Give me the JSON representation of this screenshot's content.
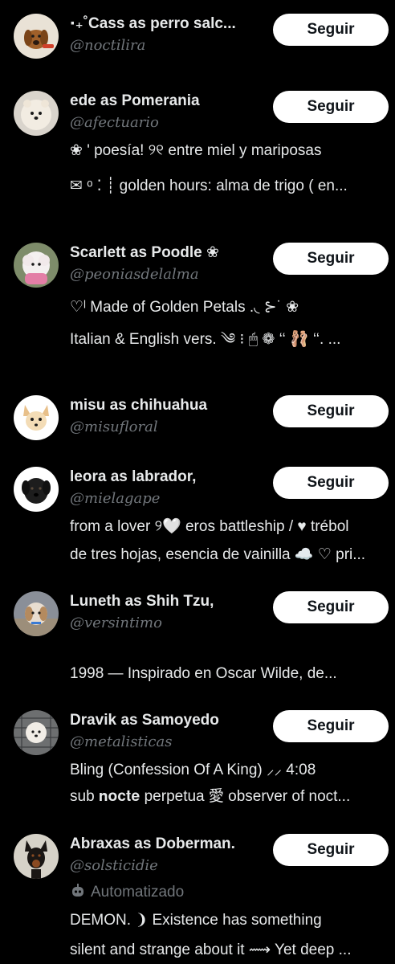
{
  "colors": {
    "background": "#000000",
    "primary_text": "#e7e9ea",
    "secondary_text": "#71767b",
    "button_bg": "#ffffff",
    "button_text": "#0f1419"
  },
  "users": [
    {
      "display_name": "‧₊˚Cass as perro salc...",
      "handle": "@noctilira",
      "follow_label": "Seguir",
      "avatar_icon": "dachshund-avatar",
      "bio": []
    },
    {
      "display_name": "ede as Pomerania",
      "handle": "@afectuario",
      "follow_label": "Seguir",
      "avatar_icon": "pomeranian-avatar",
      "bio": [
        "❀ '    poesía! ୨୧    entre miel y mariposas",
        "✉︎ ᵒ ⁚ ┊ golden hours: alma de trigo ( en..."
      ]
    },
    {
      "display_name": "Scarlett as Poodle ❀",
      "handle": "@peoniasdelalma",
      "follow_label": "Seguir",
      "avatar_icon": "poodle-avatar",
      "bio": [
        "♡ˡ    Made of Golden Petals    .◟    ⊱˙ ❀",
        "Italian & English vers. ༄    ⁝ 🖱 ❁ ‘‘ 🩰 ‘‘. ..."
      ]
    },
    {
      "display_name": "misu as chihuahua",
      "handle": "@misufloral",
      "follow_label": "Seguir",
      "avatar_icon": "chihuahua-avatar",
      "bio": []
    },
    {
      "display_name": "leora as labrador,",
      "handle": "@mielagape",
      "follow_label": "Seguir",
      "avatar_icon": "labrador-avatar",
      "bio": [
        "from a lover ୨🤍 eros battleship / ♥ trébol",
        "de tres hojas, esencia de vainilla ☁️ ♡ pri..."
      ]
    },
    {
      "display_name": "Luneth as Shih Tzu,",
      "handle": "@versintimo",
      "follow_label": "Seguir",
      "avatar_icon": "shih-tzu-avatar",
      "bio": [
        "",
        "1998    —    Inspirado en Oscar Wilde, de..."
      ]
    },
    {
      "display_name": "Dravik as Samoyedo",
      "handle": "@metalisticas",
      "follow_label": "Seguir",
      "avatar_icon": "samoyed-avatar",
      "bio": [
        "    Bling (Confession Of A King) ⸝⸝  4:08",
        "sub 𝐧𝐨𝐜𝐭𝐞 perpetua  愛  observer of noct..."
      ]
    },
    {
      "display_name": "Abraxas as Doberman.",
      "handle": "@solsticidie",
      "follow_label": "Seguir",
      "avatar_icon": "doberman-avatar",
      "automated_label": "Automatizado",
      "bio": [
        "DEMON.  ❩ Existence has something",
        "silent and strange about it  ⟿ Yet deep ..."
      ]
    }
  ]
}
